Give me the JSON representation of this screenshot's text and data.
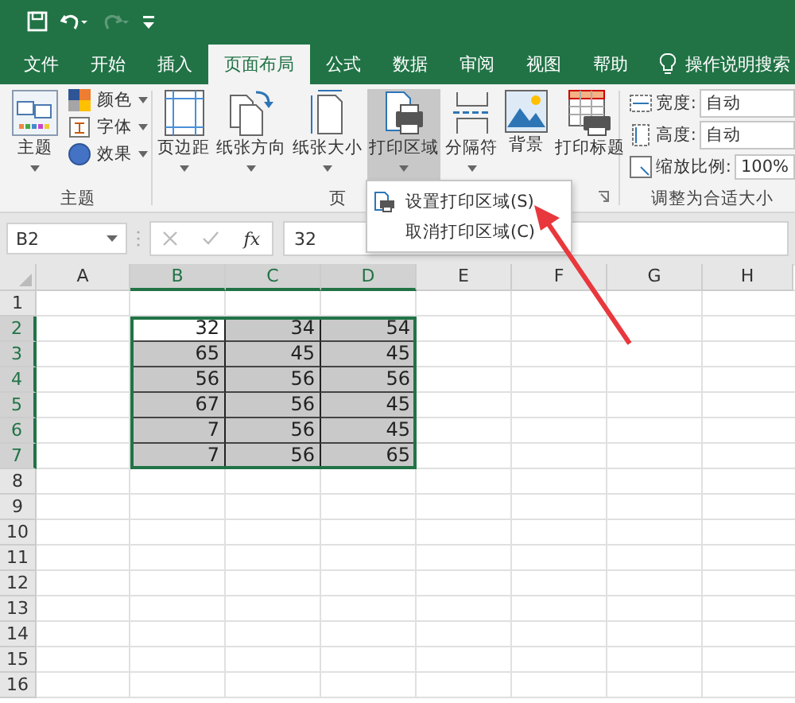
{
  "tabs": [
    {
      "label": "文件",
      "selected": false
    },
    {
      "label": "开始",
      "selected": false
    },
    {
      "label": "插入",
      "selected": false
    },
    {
      "label": "页面布局",
      "selected": true
    },
    {
      "label": "公式",
      "selected": false
    },
    {
      "label": "数据",
      "selected": false
    },
    {
      "label": "审阅",
      "selected": false
    },
    {
      "label": "视图",
      "selected": false
    },
    {
      "label": "帮助",
      "selected": false
    }
  ],
  "tell_me": "操作说明搜索",
  "ribbon": {
    "theme_group": {
      "label": "主题",
      "theme_button": "主题",
      "small_buttons": [
        {
          "kind": "colors",
          "label": "颜色"
        },
        {
          "kind": "fonts",
          "label": "字体"
        },
        {
          "kind": "effects",
          "label": "效果"
        }
      ]
    },
    "page_setup_group": {
      "label": "页",
      "buttons": [
        {
          "kind": "margins",
          "label": "页边距",
          "pressed": false
        },
        {
          "kind": "orientation",
          "label": "纸张方向",
          "pressed": false
        },
        {
          "kind": "size",
          "label": "纸张大小",
          "pressed": false
        },
        {
          "kind": "print_area",
          "label": "打印区域",
          "pressed": true
        },
        {
          "kind": "breaks",
          "label": "分隔符",
          "pressed": false
        },
        {
          "kind": "background",
          "label": "背景",
          "pressed": false
        },
        {
          "kind": "print_titles",
          "label": "打印标题",
          "pressed": false
        }
      ]
    },
    "scale_group": {
      "label": "调整为合适大小",
      "fields": [
        {
          "kind": "width",
          "label": "宽度:",
          "value": "自动"
        },
        {
          "kind": "height",
          "label": "高度:",
          "value": "自动"
        },
        {
          "kind": "scale",
          "label": "缩放比例:",
          "value": "100%"
        }
      ]
    }
  },
  "dropdown_menu": [
    {
      "label": "设置打印区域(S)",
      "icon": true
    },
    {
      "label": "取消打印区域(C)",
      "icon": false
    }
  ],
  "formula_bar": {
    "name_box": "B2",
    "function_label": "fx",
    "value": "32"
  },
  "sheet": {
    "columns": [
      {
        "label": "A",
        "selected": false
      },
      {
        "label": "B",
        "selected": true
      },
      {
        "label": "C",
        "selected": true
      },
      {
        "label": "D",
        "selected": true
      },
      {
        "label": "E",
        "selected": false
      },
      {
        "label": "F",
        "selected": false
      },
      {
        "label": "G",
        "selected": false
      },
      {
        "label": "H",
        "selected": false
      }
    ],
    "rows": [
      {
        "label": "1",
        "selected": false,
        "cells": []
      },
      {
        "label": "2",
        "selected": true,
        "cells": [
          {
            "value": "32",
            "active": true
          },
          {
            "value": "34",
            "active": false
          },
          {
            "value": "54",
            "active": false
          }
        ]
      },
      {
        "label": "3",
        "selected": true,
        "cells": [
          {
            "value": "65",
            "active": false
          },
          {
            "value": "45",
            "active": false
          },
          {
            "value": "45",
            "active": false
          }
        ]
      },
      {
        "label": "4",
        "selected": true,
        "cells": [
          {
            "value": "56",
            "active": false
          },
          {
            "value": "56",
            "active": false
          },
          {
            "value": "56",
            "active": false
          }
        ]
      },
      {
        "label": "5",
        "selected": true,
        "cells": [
          {
            "value": "67",
            "active": false
          },
          {
            "value": "56",
            "active": false
          },
          {
            "value": "45",
            "active": false
          }
        ]
      },
      {
        "label": "6",
        "selected": true,
        "cells": [
          {
            "value": "7",
            "active": false
          },
          {
            "value": "56",
            "active": false
          },
          {
            "value": "45",
            "active": false
          }
        ]
      },
      {
        "label": "7",
        "selected": true,
        "cells": [
          {
            "value": "7",
            "active": false
          },
          {
            "value": "56",
            "active": false
          },
          {
            "value": "65",
            "active": false
          }
        ]
      },
      {
        "label": "8",
        "selected": false,
        "cells": []
      },
      {
        "label": "9",
        "selected": false,
        "cells": []
      },
      {
        "label": "10",
        "selected": false,
        "cells": []
      },
      {
        "label": "11",
        "selected": false,
        "cells": []
      },
      {
        "label": "12",
        "selected": false,
        "cells": []
      },
      {
        "label": "13",
        "selected": false,
        "cells": []
      },
      {
        "label": "14",
        "selected": false,
        "cells": []
      },
      {
        "label": "15",
        "selected": false,
        "cells": []
      },
      {
        "label": "16",
        "selected": false,
        "cells": []
      }
    ]
  }
}
